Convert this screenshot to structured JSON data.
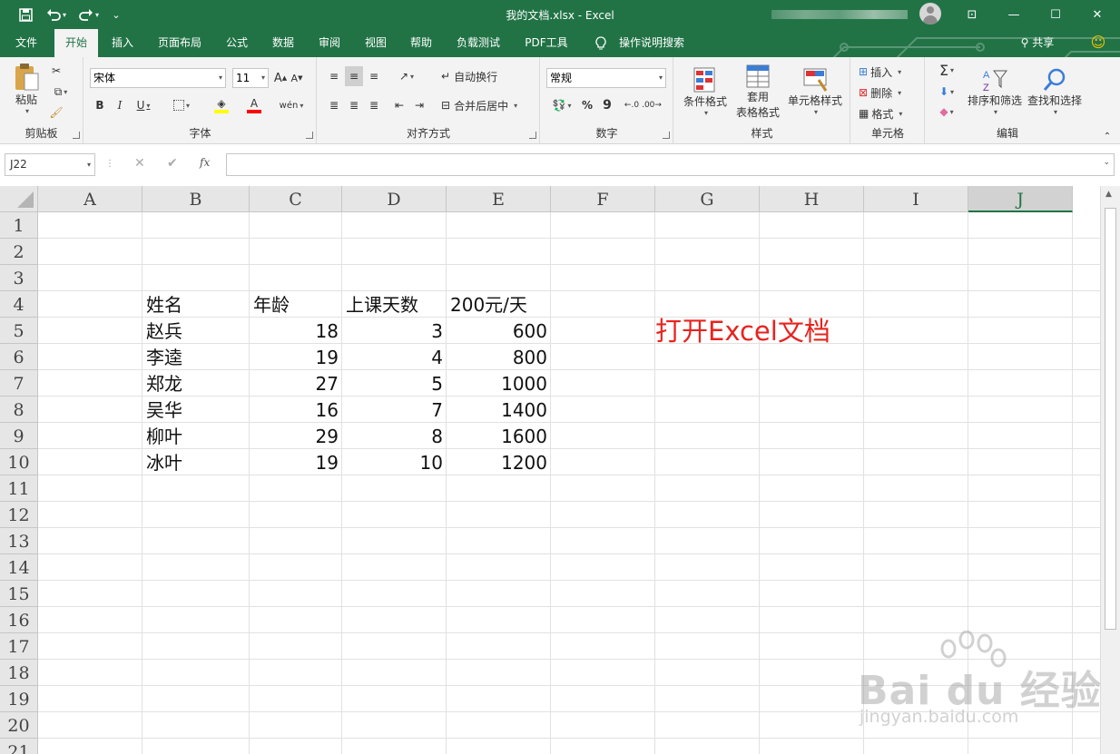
{
  "window": {
    "title": "我的文档.xlsx  -  Excel",
    "controls": {
      "ribbon_display": "⊡",
      "minimize": "—",
      "maximize": "☐",
      "close": "✕"
    }
  },
  "quick_access": {
    "save": "💾",
    "undo": "↶",
    "redo": "↷",
    "customize": "⌄"
  },
  "tabs": [
    "文件",
    "开始",
    "插入",
    "页面布局",
    "公式",
    "数据",
    "审阅",
    "视图",
    "帮助",
    "负载测试",
    "PDF工具",
    "操作说明搜索"
  ],
  "active_tab": "开始",
  "share": "共享",
  "ribbon": {
    "clipboard": {
      "label": "剪贴板",
      "paste": "粘贴"
    },
    "font": {
      "label": "字体",
      "name": "宋体",
      "size": "11",
      "bold": "B",
      "italic": "I",
      "underline": "U",
      "grow": "A",
      "shrink": "A",
      "phonetic": "wén"
    },
    "alignment": {
      "label": "对齐方式",
      "wrap": "自动换行",
      "merge": "合并后居中"
    },
    "number": {
      "label": "数字",
      "format": "常规",
      "percent": "%",
      "comma": "9"
    },
    "styles": {
      "label": "样式",
      "conditional": "条件格式",
      "table_1": "套用",
      "table_2": "表格格式",
      "cell_styles": "单元格样式"
    },
    "cells": {
      "label": "单元格",
      "insert": "插入",
      "delete": "删除",
      "format": "格式"
    },
    "editing": {
      "label": "编辑",
      "sort": "排序和筛选",
      "find": "查找和选择"
    }
  },
  "formula_bar": {
    "name_box": "J22",
    "cancel": "✕",
    "enter": "✔",
    "fx": "fx",
    "content": ""
  },
  "columns": [
    "A",
    "B",
    "C",
    "D",
    "E",
    "F",
    "G",
    "H",
    "I",
    "J"
  ],
  "selected_column": "J",
  "rows": [
    "1",
    "2",
    "3",
    "4",
    "5",
    "6",
    "7",
    "8",
    "9",
    "10",
    "11",
    "12",
    "13",
    "14",
    "15",
    "16",
    "17",
    "18",
    "19",
    "20",
    "21"
  ],
  "table": {
    "headers": [
      "姓名",
      "年龄",
      "上课天数",
      "200元/天"
    ],
    "rows": [
      [
        "赵兵",
        "18",
        "3",
        "600"
      ],
      [
        "李逵",
        "19",
        "4",
        "800"
      ],
      [
        "郑龙",
        "27",
        "5",
        "1000"
      ],
      [
        "吴华",
        "16",
        "7",
        "1400"
      ],
      [
        "柳叶",
        "29",
        "8",
        "1600"
      ],
      [
        "冰叶",
        "19",
        "10",
        "1200"
      ]
    ]
  },
  "annotation": "打开Excel文档",
  "watermark": {
    "brand": "Bai du 经验",
    "url": "jingyan.baidu.com"
  },
  "colors": {
    "excel_green": "#217346",
    "annotation_red": "#e8231e",
    "ribbon_bg": "#f3f3f3"
  }
}
